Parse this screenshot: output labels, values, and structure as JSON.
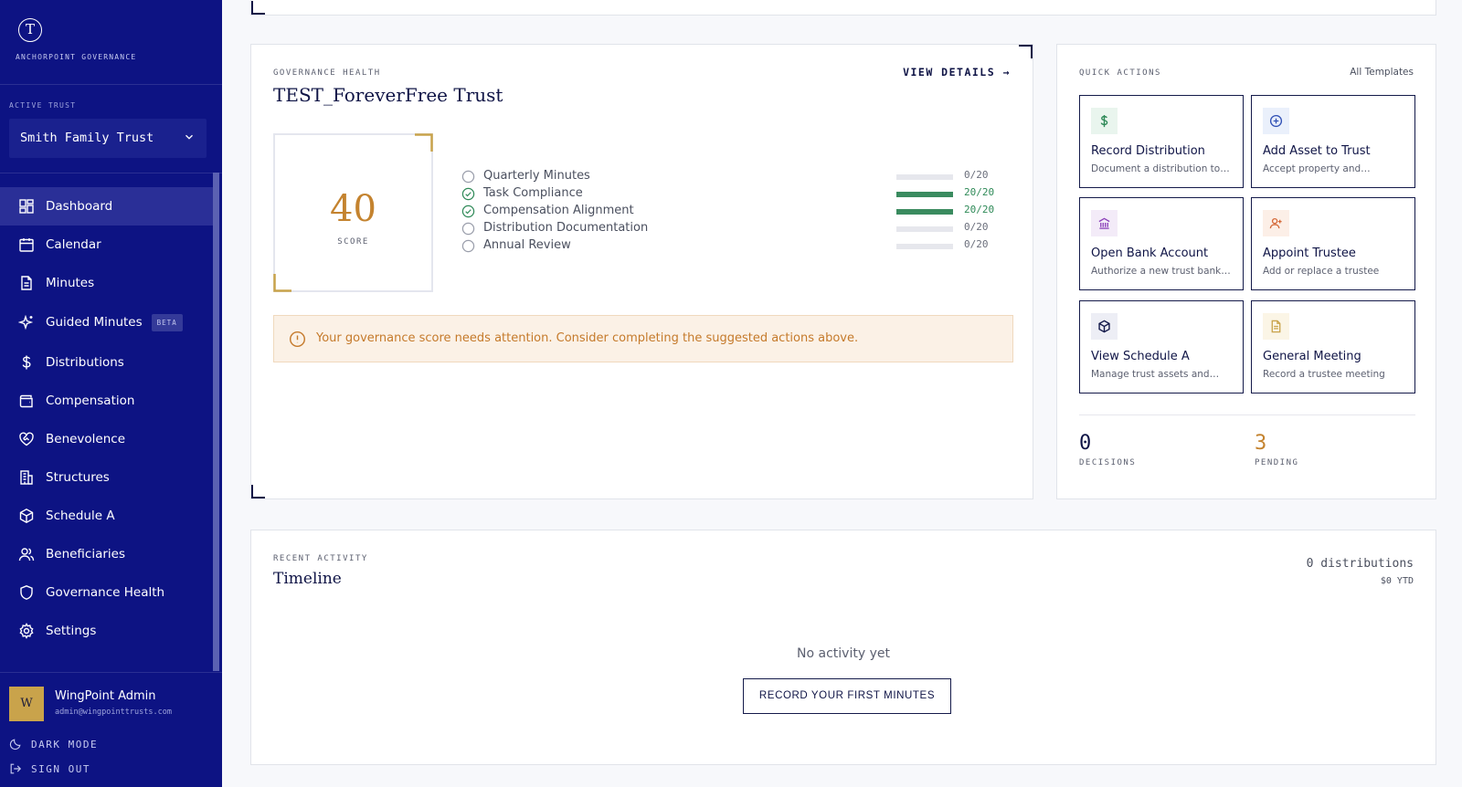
{
  "brand": {
    "logo_letter": "T",
    "name": "ANCHORPOINT GOVERNANCE"
  },
  "trust_selector": {
    "label": "ACTIVE TRUST",
    "value": "Smith Family Trust"
  },
  "nav": {
    "items": [
      {
        "label": "Dashboard",
        "icon": "dashboard-icon",
        "active": true
      },
      {
        "label": "Calendar",
        "icon": "calendar-icon"
      },
      {
        "label": "Minutes",
        "icon": "document-icon"
      },
      {
        "label": "Guided Minutes",
        "icon": "sparkle-icon",
        "badge": "BETA"
      },
      {
        "label": "Distributions",
        "icon": "dollar-icon"
      },
      {
        "label": "Compensation",
        "icon": "wallet-icon"
      },
      {
        "label": "Benevolence",
        "icon": "heart-handshake-icon"
      },
      {
        "label": "Structures",
        "icon": "building-icon"
      },
      {
        "label": "Schedule A",
        "icon": "box-icon"
      },
      {
        "label": "Beneficiaries",
        "icon": "users-icon"
      },
      {
        "label": "Governance Health",
        "icon": "shield-icon"
      },
      {
        "label": "Settings",
        "icon": "gear-icon"
      }
    ]
  },
  "user": {
    "initial": "W",
    "name": "WingPoint Admin",
    "email": "admin@wingpointtrusts.com"
  },
  "sidebar_actions": {
    "dark_mode": "DARK MODE",
    "sign_out": "SIGN OUT"
  },
  "governance": {
    "eyebrow": "GOVERNANCE HEALTH",
    "title": "TEST_ForeverFree Trust",
    "view_details": "VIEW DETAILS →",
    "score": "40",
    "score_label": "SCORE",
    "metrics": [
      {
        "label": "Quarterly Minutes",
        "value": "0/20",
        "fraction": 0,
        "complete": false
      },
      {
        "label": "Task Compliance",
        "value": "20/20",
        "fraction": 1,
        "complete": true
      },
      {
        "label": "Compensation Alignment",
        "value": "20/20",
        "fraction": 1,
        "complete": true
      },
      {
        "label": "Distribution Documentation",
        "value": "0/20",
        "fraction": 0,
        "complete": false
      },
      {
        "label": "Annual Review",
        "value": "0/20",
        "fraction": 0,
        "complete": false
      }
    ],
    "alert": "Your governance score needs attention. Consider completing the suggested actions above."
  },
  "quick_actions": {
    "eyebrow": "QUICK ACTIONS",
    "link": "All Templates",
    "tiles": [
      {
        "title": "Record Distribution",
        "desc": "Document a distribution to…",
        "icon": "dollar-icon",
        "icon_color": "#2f8a58",
        "icon_bg": "#e9f5ee"
      },
      {
        "title": "Add Asset to Trust",
        "desc": "Accept property and…",
        "icon": "plus-circle-icon",
        "icon_color": "#2f4fb5",
        "icon_bg": "#eaf0fb"
      },
      {
        "title": "Open Bank Account",
        "desc": "Authorize a new trust bank…",
        "icon": "bank-icon",
        "icon_color": "#8a3fb8",
        "icon_bg": "#f3ebf8"
      },
      {
        "title": "Appoint Trustee",
        "desc": "Add or replace a trustee",
        "icon": "user-plus-icon",
        "icon_color": "#d56a3a",
        "icon_bg": "#fcefe7"
      },
      {
        "title": "View Schedule A",
        "desc": "Manage trust assets and…",
        "icon": "box-icon",
        "icon_color": "#141a4a",
        "icon_bg": "#edeef5"
      },
      {
        "title": "General Meeting",
        "desc": "Record a trustee meeting",
        "icon": "document-icon",
        "icon_color": "#c9a34b",
        "icon_bg": "#fbf5e6"
      }
    ],
    "stats": [
      {
        "value": "0",
        "label": "DECISIONS"
      },
      {
        "value": "3",
        "label": "PENDING"
      }
    ]
  },
  "recent_activity": {
    "eyebrow": "RECENT ACTIVITY",
    "title": "Timeline",
    "count": "0 distributions",
    "ytd": "$0 YTD",
    "empty": "No activity yet",
    "button": "RECORD YOUR FIRST MINUTES"
  },
  "colors": {
    "sidebar": "#0d1383",
    "accent_gold": "#c4832f",
    "success": "#2f8a58",
    "warning": "#c57a2b"
  }
}
